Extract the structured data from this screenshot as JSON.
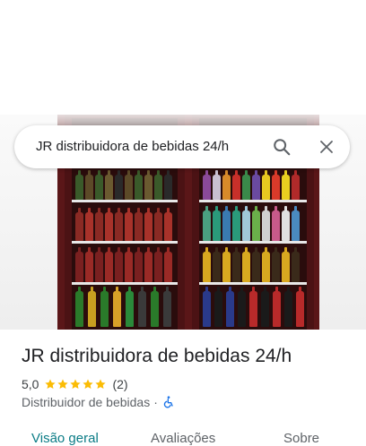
{
  "search": {
    "query": "JR distribuidora de bebidas 24/h",
    "search_icon": "search-icon",
    "close_icon": "close-icon"
  },
  "photo": {
    "icon": "storefront-photo"
  },
  "place": {
    "title": "JR distribuidora de bebidas 24/h",
    "rating": "5,0",
    "stars": 5,
    "review_count": "(2)",
    "category": "Distribuidor de bebidas",
    "separator": "·",
    "accessibility_icon": "wheelchair-icon"
  },
  "tabs": [
    {
      "label": "Visão geral",
      "active": true
    },
    {
      "label": "Avaliações",
      "active": false
    },
    {
      "label": "Sobre",
      "active": false
    }
  ],
  "colors": {
    "accent": "#0b7c86",
    "star": "#fbbc04",
    "accessible": "#1a73e8"
  }
}
